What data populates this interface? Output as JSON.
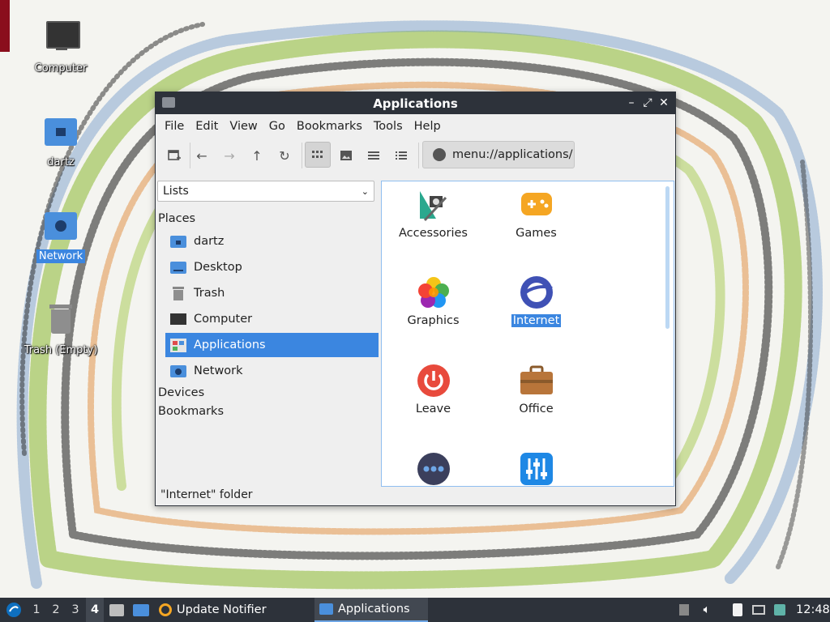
{
  "desktop": {
    "icons": [
      {
        "label": "Computer"
      },
      {
        "label": "dartz"
      },
      {
        "label": "Network"
      },
      {
        "label": "Trash (Empty)"
      }
    ]
  },
  "window": {
    "title": "Applications",
    "controls": {
      "minimize": "–",
      "maximize": "⤢",
      "close": "✕"
    },
    "menu": [
      "File",
      "Edit",
      "View",
      "Go",
      "Bookmarks",
      "Tools",
      "Help"
    ],
    "path": "menu://applications/",
    "sidebar": {
      "mode": "Lists",
      "places_heading": "Places",
      "places": [
        "dartz",
        "Desktop",
        "Trash",
        "Computer",
        "Applications",
        "Network"
      ],
      "selected_place": "Applications",
      "devices_heading": "Devices",
      "bookmarks_heading": "Bookmarks"
    },
    "items": [
      "Accessories",
      "Games",
      "Graphics",
      "Internet",
      "Leave",
      "Office",
      "",
      ""
    ],
    "selected_item": "Internet",
    "status": "\"Internet\" folder"
  },
  "taskbar": {
    "workspaces": [
      "1",
      "2",
      "3",
      "4"
    ],
    "current_workspace": "4",
    "tasks": [
      "Update Notifier",
      "Applications"
    ],
    "active_task": "Applications",
    "clock": "12:48"
  },
  "colors": {
    "accent": "#3b86e0",
    "titlebar": "#2d323a",
    "folder": "#4a8fdc"
  }
}
